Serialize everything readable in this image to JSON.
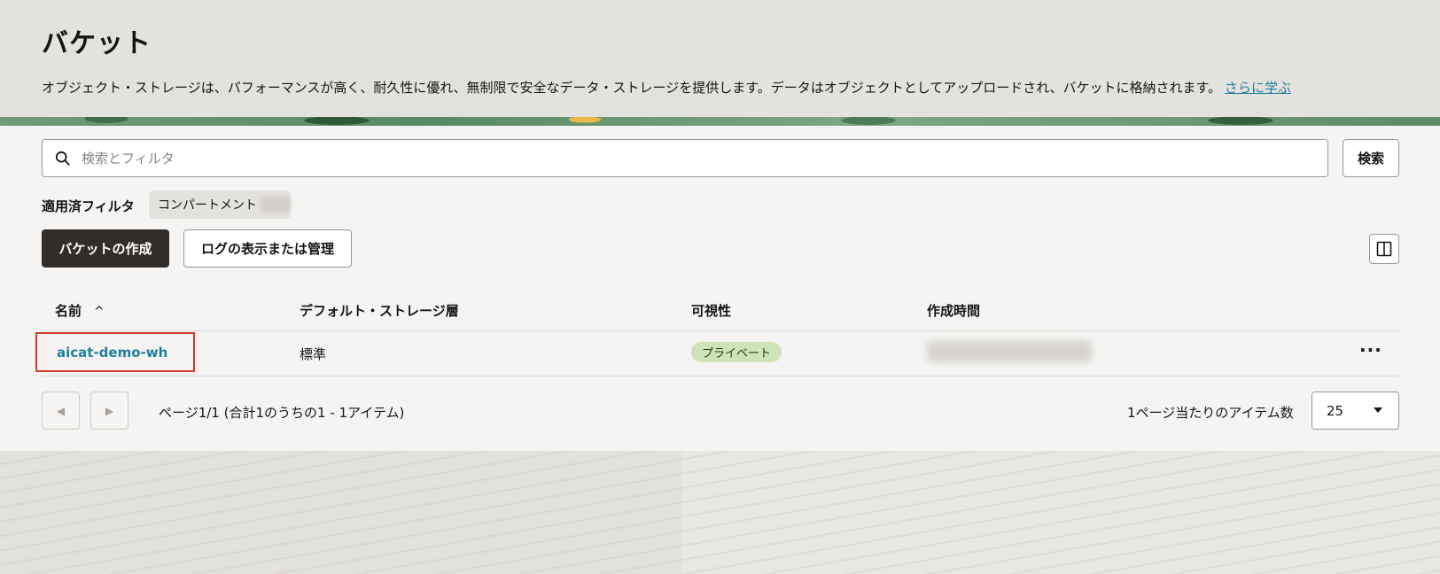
{
  "header": {
    "title": "バケット",
    "description": "オブジェクト・ストレージは、パフォーマンスが高く、耐久性に優れ、無制限で安全なデータ・ストレージを提供します。データはオブジェクトとしてアップロードされ、バケットに格納されます。",
    "learn_more": "さらに学ぶ"
  },
  "search": {
    "placeholder": "検索とフィルタ",
    "button_label": "検索"
  },
  "filters": {
    "label": "適用済フィルタ",
    "chip_label": "コンパートメント"
  },
  "toolbar": {
    "create_label": "バケットの作成",
    "logs_label": "ログの表示または管理"
  },
  "table": {
    "columns": [
      "名前",
      "デフォルト・ストレージ層",
      "可視性",
      "作成時間"
    ],
    "sort_icon": "chevron-up-icon",
    "rows": [
      {
        "name": "aicat-demo-wh",
        "storage_tier": "標準",
        "visibility": "プライベート",
        "actions": "···"
      }
    ]
  },
  "pagination": {
    "info": "ページ1/1 (合計1のうちの1 - 1アイテム)",
    "per_page_label": "1ページ当たりのアイテム数",
    "per_page_value": "25"
  },
  "colors": {
    "primary_dark": "#312d2a",
    "link": "#227e9e",
    "badge_bg": "#cfe3b9",
    "highlight": "#d1392a"
  }
}
